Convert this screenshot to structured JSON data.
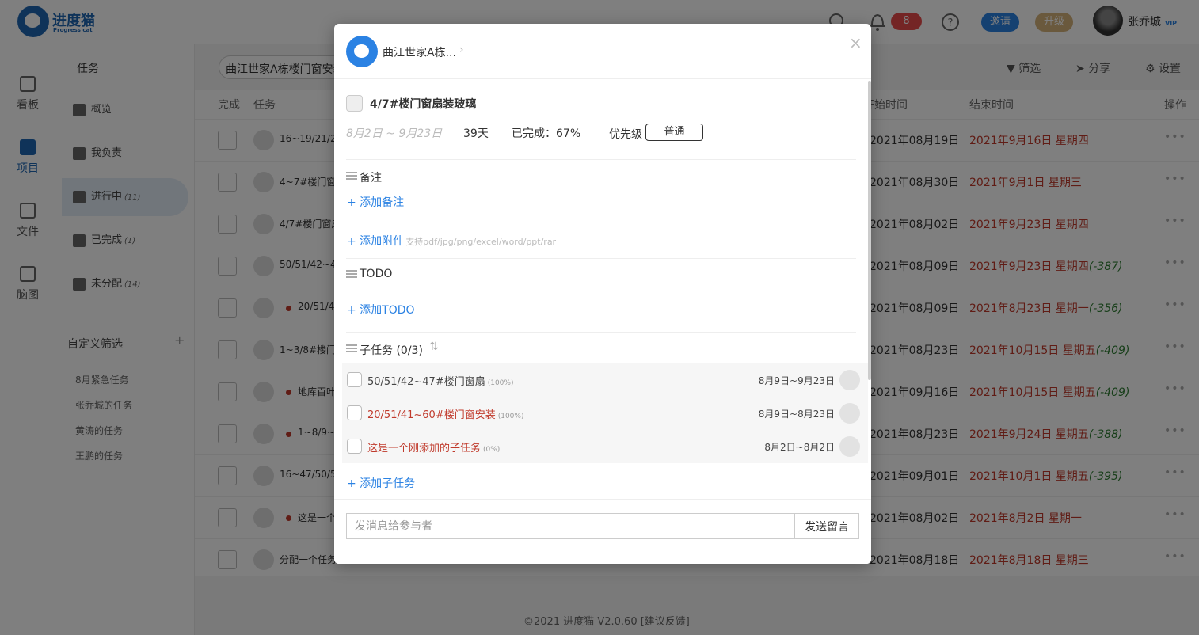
{
  "app": {
    "name": "进度猫",
    "sub": "Progress cat",
    "notif_count": "8",
    "invite": "邀请",
    "upgrade": "升级",
    "user": "张乔城",
    "vip": "VIP"
  },
  "nav": [
    {
      "label": "看板"
    },
    {
      "label": "项目"
    },
    {
      "label": "文件"
    },
    {
      "label": "脑图"
    }
  ],
  "tasks_panel": {
    "title": "任务",
    "items": [
      {
        "label": "概览",
        "count": ""
      },
      {
        "label": "我负责",
        "count": ""
      },
      {
        "label": "进行中",
        "count": "(11)"
      },
      {
        "label": "已完成",
        "count": "(1)"
      },
      {
        "label": "未分配",
        "count": "(14)"
      }
    ],
    "custom_title": "自定义筛选",
    "custom_add": "+",
    "filters": [
      "8月紧急任务",
      "张乔城的任务",
      "黄涛的任务",
      "王鹏的任务"
    ]
  },
  "main": {
    "search_value": "曲江世家A栋楼门窗安装",
    "filter_btn": "筛选",
    "share_btn": "分享",
    "settings_btn": "设置",
    "headers": {
      "done": "完成",
      "task": "任务",
      "start": "开始时间",
      "end": "结束时间",
      "ops": "操作"
    },
    "rows": [
      {
        "name": "16~19/21/28/",
        "dot": false,
        "start": "2021年08月19日",
        "end": "2021年9月16日 星期四",
        "over": ""
      },
      {
        "name": "4~7#楼门窗扇",
        "dot": false,
        "start": "2021年08月30日",
        "end": "2021年9月1日 星期三",
        "over": ""
      },
      {
        "name": "4/7#楼门窗扇",
        "dot": false,
        "start": "2021年08月02日",
        "end": "2021年9月23日 星期四",
        "over": ""
      },
      {
        "name": "50/51/42~47",
        "dot": false,
        "start": "2021年08月09日",
        "end": "2021年9月23日 星期四",
        "over": "(-387)"
      },
      {
        "name": "20/51/41",
        "dot": true,
        "start": "2021年08月09日",
        "end": "2021年8月23日 星期一",
        "over": "(-356)"
      },
      {
        "name": "1~3/8#楼门窗",
        "dot": false,
        "start": "2021年08月23日",
        "end": "2021年10月15日 星期五",
        "over": "(-409)"
      },
      {
        "name": "地库百叶",
        "dot": true,
        "start": "2021年09月16日",
        "end": "2021年10月15日 星期五",
        "over": "(-409)"
      },
      {
        "name": "1~8/9~1",
        "dot": true,
        "start": "2021年08月23日",
        "end": "2021年9月24日 星期五",
        "over": "(-388)"
      },
      {
        "name": "16~47/50/51",
        "dot": false,
        "start": "2021年09月01日",
        "end": "2021年10月1日 星期五",
        "over": "(-395)"
      },
      {
        "name": "这是一个",
        "dot": true,
        "start": "2021年08月02日",
        "end": "2021年8月2日 星期一",
        "over": ""
      },
      {
        "name": "分配一个任务",
        "dot": false,
        "start": "2021年08月18日",
        "end": "2021年8月18日 星期三",
        "over": ""
      }
    ],
    "footer": "©2021 进度猫 V2.0.60 [建议反馈]"
  },
  "modal": {
    "project": "曲江世家A栋...",
    "close": "×",
    "task_title": "4/7#楼门窗扇装玻璃",
    "date_range": "8月2日 ~ 9月23日",
    "days": "39天",
    "done": "已完成：67%",
    "priority_label": "优先级",
    "priority_value": "普通",
    "notes_title": "备注",
    "add_note": "+ 添加备注",
    "add_attach": "+ 添加附件",
    "attach_hint": "支持pdf/jpg/png/excel/word/ppt/rar",
    "todo_title": "TODO",
    "add_todo": "+ 添加TODO",
    "subtasks_title": "子任务 (0/3)",
    "subtasks": [
      {
        "name": "50/51/42~47#楼门窗扇",
        "pct": "(100%)",
        "range": "8月9日~9月23日",
        "red": false
      },
      {
        "name": "20/51/41~60#楼门窗安装",
        "pct": "(100%)",
        "range": "8月9日~8月23日",
        "red": true
      },
      {
        "name": "这是一个刚添加的子任务",
        "pct": "(0%)",
        "range": "8月2日~8月2日",
        "red": true
      }
    ],
    "add_subtask": "+ 添加子任务",
    "msg_placeholder": "发消息给参与者",
    "send": "发送留言"
  },
  "colors": {
    "accent": "#2b82e3",
    "brand": "#1f66b3",
    "danger": "#c0392b",
    "overdue": "#2e7d32"
  }
}
